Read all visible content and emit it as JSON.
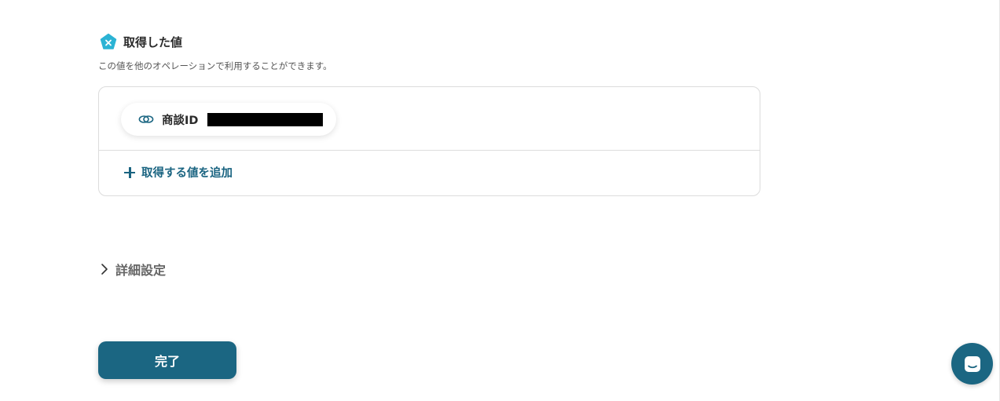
{
  "section": {
    "title": "取得した値",
    "description": "この値を他のオペレーションで利用することができます。"
  },
  "values": {
    "chip": {
      "label": "商談ID",
      "value": ""
    },
    "add_label": "取得する値を追加"
  },
  "advanced": {
    "label": "詳細設定"
  },
  "actions": {
    "done_label": "完了"
  },
  "colors": {
    "accent": "#1b6682",
    "pentagon": "#2bb3d4",
    "redacted": "#000000"
  },
  "icons": {
    "section": "pentagon-x-icon",
    "chip": "link-icon",
    "add": "plus-icon",
    "advanced": "chevron-right-icon",
    "chat": "chat-icon"
  }
}
